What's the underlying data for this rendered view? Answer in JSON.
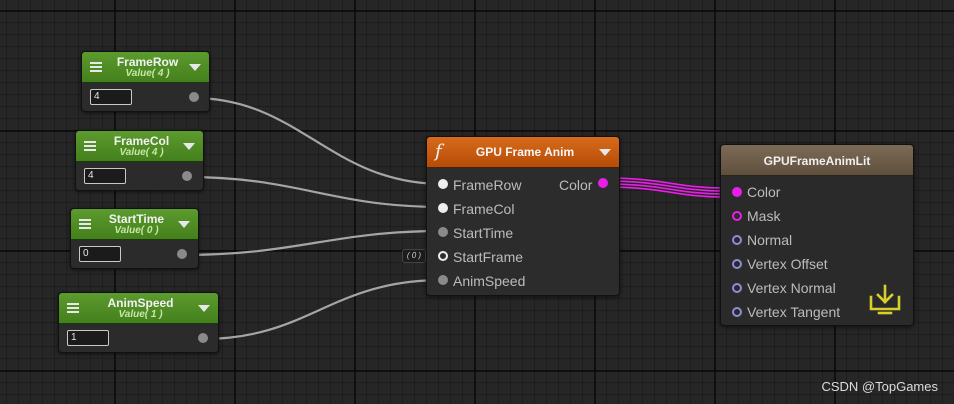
{
  "property_nodes": [
    {
      "title": "FrameRow",
      "subtitle": "Value( 4 )",
      "value": "4"
    },
    {
      "title": "FrameCol",
      "subtitle": "Value( 4 )",
      "value": "4"
    },
    {
      "title": "StartTime",
      "subtitle": "Value( 0 )",
      "value": "0"
    },
    {
      "title": "AnimSpeed",
      "subtitle": "Value( 1 )",
      "value": "1"
    }
  ],
  "function_node": {
    "title": "GPU Frame Anim",
    "icon": "function-fx-icon",
    "output_label": "Color",
    "inputs": [
      "FrameRow",
      "FrameCol",
      "StartTime",
      "StartFrame",
      "AnimSpeed"
    ],
    "startframe_default": "( 0 )"
  },
  "output_node": {
    "title": "GPUFrameAnimLit",
    "inputs": [
      "Color",
      "Mask",
      "Normal",
      "Vertex Offset",
      "Vertex Normal",
      "Vertex Tangent"
    ],
    "icon": "download-to-display-icon"
  },
  "colors": {
    "property_header": "#4f8f25",
    "function_header": "#c75c10",
    "output_header": "#6d5d49",
    "color_wire": "#e81fe8",
    "float_wire": "#9a9a9a",
    "output_icon": "#d8d02a"
  },
  "watermark": "CSDN @TopGames"
}
